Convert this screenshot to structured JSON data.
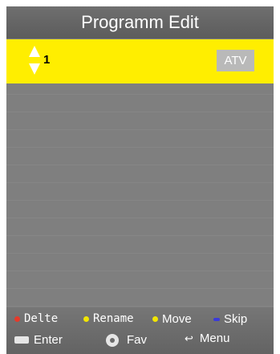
{
  "header": {
    "title": "Programm Edit"
  },
  "channel_list": {
    "selected": {
      "number": "1",
      "type": "ATV"
    }
  },
  "footer": {
    "delete_label": "Delte",
    "rename_label": "Rename",
    "move_label": "Move",
    "skip_label": "Skip",
    "enter_label": "Enter",
    "fav_label": "Fav",
    "menu_label": "Menu"
  },
  "colors": {
    "selected_row": "#ffee00",
    "delete_dot": "#e53a2a",
    "rename_dot": "#f2e600",
    "move_dot": "#f2e600",
    "skip_dot": "#3a3ad9",
    "badge": "#b9b9b9"
  }
}
